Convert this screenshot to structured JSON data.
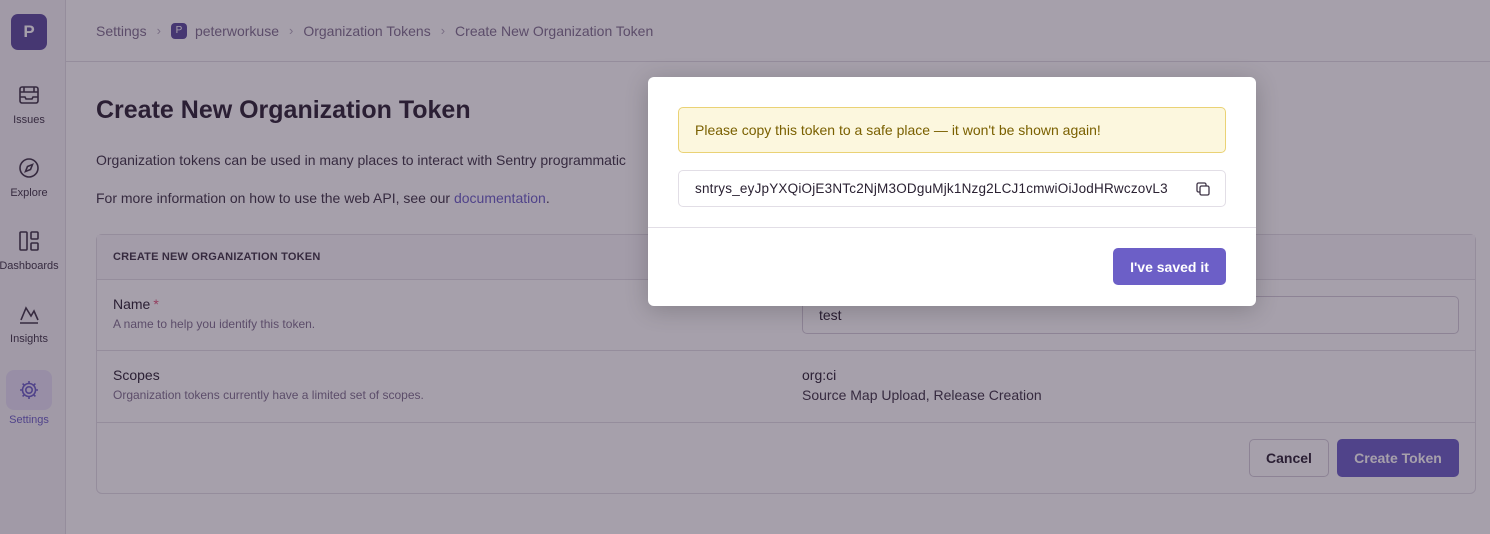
{
  "sidebar": {
    "org_initial": "P",
    "items": [
      {
        "label": "Issues",
        "icon": "issues-icon"
      },
      {
        "label": "Explore",
        "icon": "compass-icon"
      },
      {
        "label": "Dashboards",
        "icon": "dashboards-icon"
      },
      {
        "label": "Insights",
        "icon": "insights-icon"
      },
      {
        "label": "Settings",
        "icon": "gear-icon",
        "active": true
      }
    ]
  },
  "breadcrumb": {
    "items": [
      "Settings",
      "peterworkuse",
      "Organization Tokens",
      "Create New Organization Token"
    ],
    "project_initial": "P"
  },
  "page": {
    "title": "Create New Organization Token",
    "description": "Organization tokens can be used in many places to interact with Sentry programmatic",
    "info_prefix": "For more information on how to use the web API, see our ",
    "info_link": "documentation",
    "info_suffix": "."
  },
  "form": {
    "header": "CREATE NEW ORGANIZATION TOKEN",
    "name_label": "Name",
    "name_required_mark": "*",
    "name_help": "A name to help you identify this token.",
    "name_value": "test",
    "scopes_label": "Scopes",
    "scopes_help": "Organization tokens currently have a limited set of scopes.",
    "scope_value": "org:ci",
    "scope_description": "Source Map Upload, Release Creation",
    "cancel_label": "Cancel",
    "create_label": "Create Token"
  },
  "modal": {
    "alert_text": "Please copy this token to a safe place — it won't be shown again!",
    "token": "sntrys_eyJpYXQiOjE3NTc2NjM3ODguMjk1Nzg2LCJ1cmwiOiJodHRwczovL3",
    "saved_label": "I've saved it"
  },
  "colors": {
    "accent": "#6c5fc7",
    "org_avatar": "#5b4a9e",
    "alert_bg": "#fcf7de",
    "alert_border": "#ead275"
  }
}
